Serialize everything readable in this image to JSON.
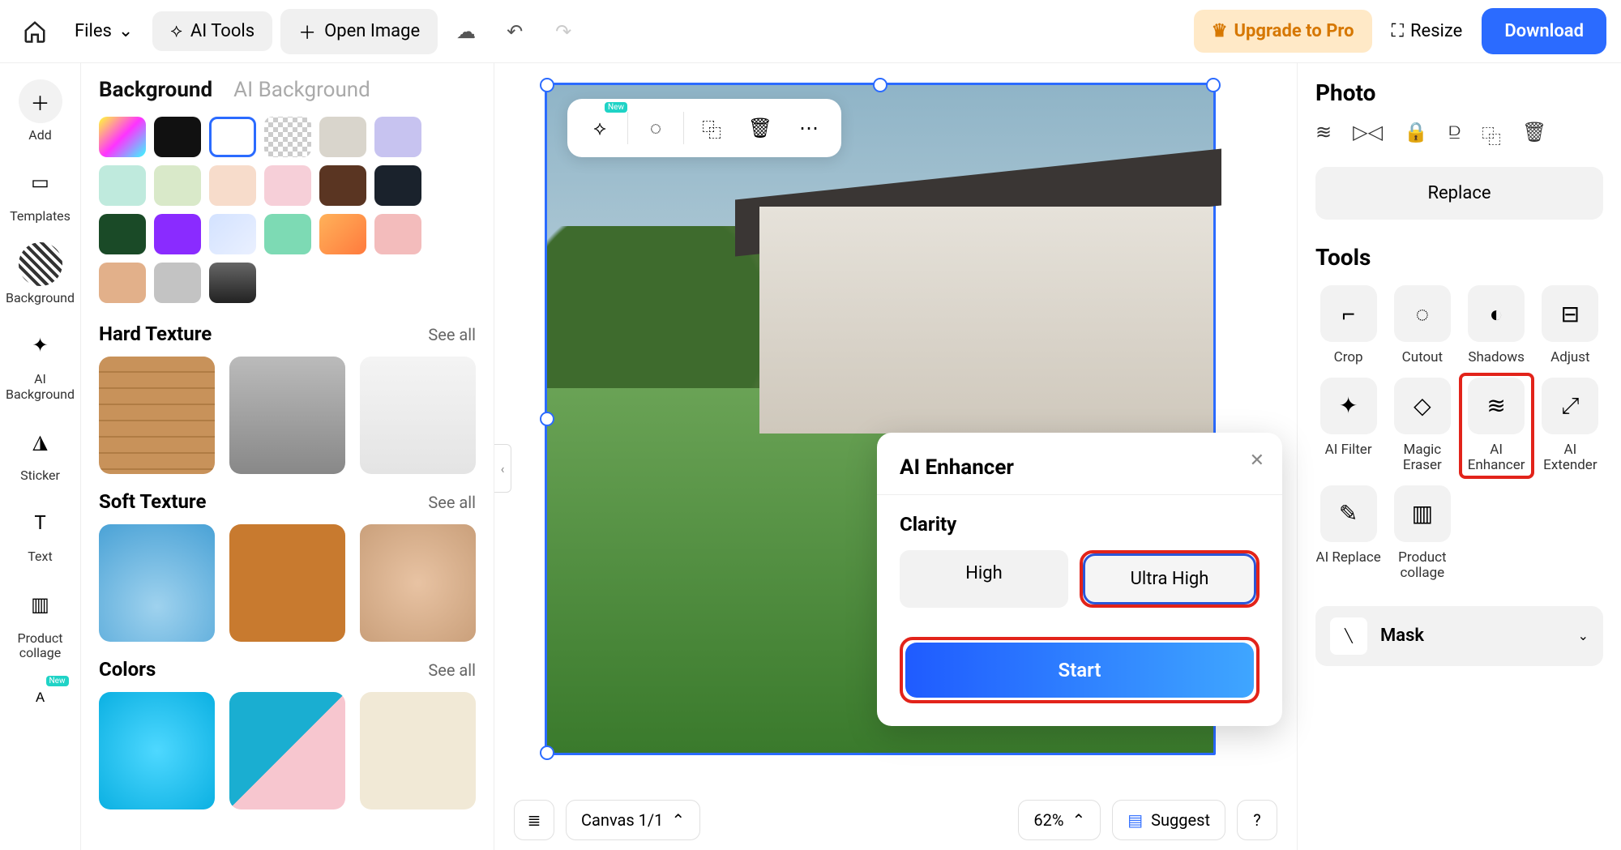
{
  "topbar": {
    "files": "Files",
    "ai_tools": "AI Tools",
    "open_image": "Open Image",
    "upgrade": "Upgrade to Pro",
    "resize": "Resize",
    "download": "Download"
  },
  "leftnav": {
    "add": "Add",
    "templates": "Templates",
    "background": "Background",
    "ai_background": "AI Background",
    "sticker": "Sticker",
    "text": "Text",
    "product_collage": "Product collage",
    "new_badge": "New"
  },
  "sidepanel": {
    "tab_background": "Background",
    "tab_ai_background": "AI Background",
    "hard_texture": "Hard Texture",
    "soft_texture": "Soft Texture",
    "colors": "Colors",
    "see_all": "See all",
    "swatches": [
      "linear-gradient(135deg,#ff3,#f3f,#3ff)",
      "#111",
      "#fff",
      "repeating-conic-gradient(#ccc 0 25%,#fff 0 50%) 50%/12px 12px",
      "#d9d5cc",
      "#c7c3f0",
      "#bfeadd",
      "#d9e9c9",
      "#f7dccb",
      "#f6cfd8",
      "#5a3522",
      "#1a222c",
      "#1a4a27",
      "#8a2bff",
      "linear-gradient(135deg,#d3e2ff,#eaf0ff)",
      "#7ddab4",
      "linear-gradient(135deg,#ffb25a,#ff7a3d)",
      "#f3bcbc",
      "#e2b08a",
      "#c3c3c3",
      "linear-gradient(#666,#222)"
    ]
  },
  "canvas": {
    "canvas_label": "Canvas 1/1",
    "zoom": "62%",
    "suggest": "Suggest",
    "help": "?"
  },
  "popover": {
    "title": "AI Enhancer",
    "clarity": "Clarity",
    "high": "High",
    "ultra_high": "Ultra High",
    "start": "Start"
  },
  "rightpanel": {
    "photo": "Photo",
    "replace": "Replace",
    "tools": "Tools",
    "tool_list": [
      {
        "name": "Crop",
        "icon": "⌐"
      },
      {
        "name": "Cutout",
        "icon": "◌"
      },
      {
        "name": "Shadows",
        "icon": "◐"
      },
      {
        "name": "Adjust",
        "icon": "⊟"
      },
      {
        "name": "AI Filter",
        "icon": "✦"
      },
      {
        "name": "Magic Eraser",
        "icon": "◇"
      },
      {
        "name": "AI Enhancer",
        "icon": "≋"
      },
      {
        "name": "AI Extender",
        "icon": "⤢"
      },
      {
        "name": "AI Replace",
        "icon": "✎"
      },
      {
        "name": "Product collage",
        "icon": "▥"
      }
    ],
    "mask": "Mask"
  }
}
